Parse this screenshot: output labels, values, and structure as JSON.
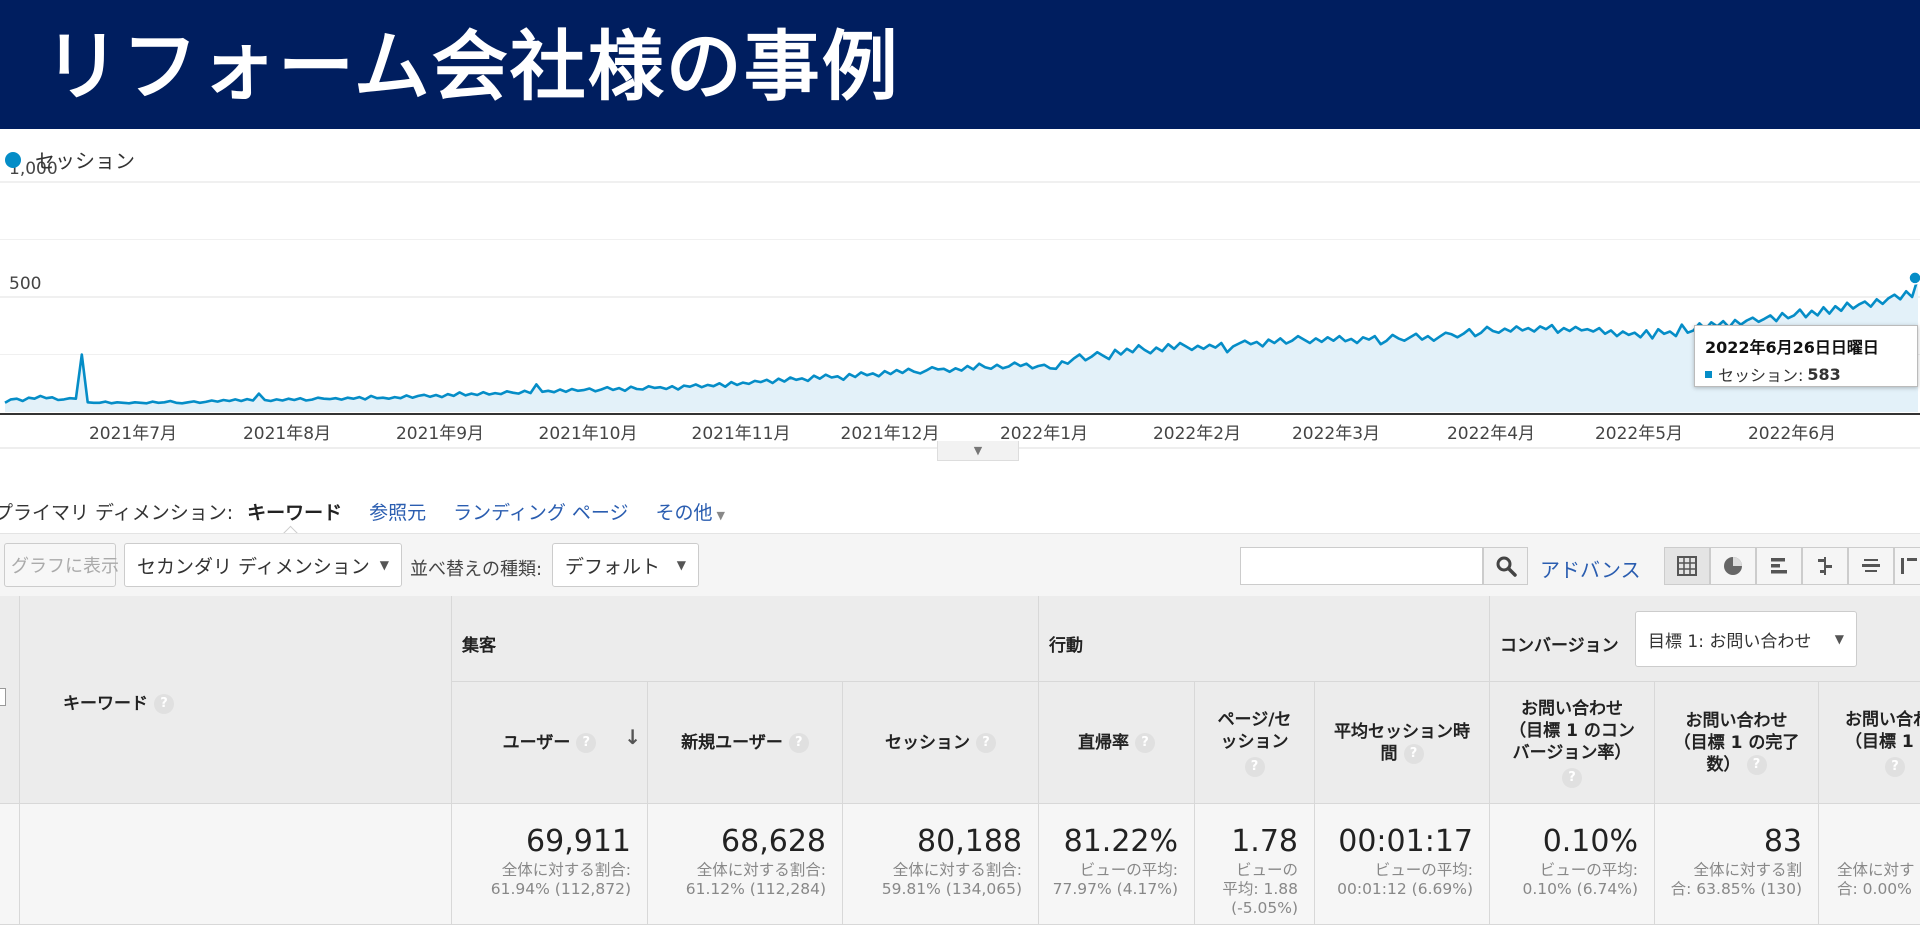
{
  "banner": {
    "title": "リフォーム会社様の事例"
  },
  "chart": {
    "legend_label": "セッション",
    "tooltip": {
      "date": "2022年6月26日日曜日",
      "label": "セッション:",
      "value": "583"
    }
  },
  "chart_data": {
    "type": "area",
    "series": [
      {
        "name": "セッション",
        "values": [
          40,
          55,
          58,
          48,
          62,
          58,
          70,
          60,
          64,
          52,
          55,
          60,
          58,
          250,
          42,
          40,
          40,
          45,
          38,
          42,
          40,
          38,
          42,
          40,
          38,
          45,
          40,
          42,
          48,
          40,
          38,
          42,
          46,
          40,
          44,
          50,
          45,
          52,
          48,
          55,
          48,
          56,
          50,
          80,
          52,
          48,
          55,
          50,
          58,
          52,
          60,
          50,
          54,
          62,
          58,
          56,
          60,
          54,
          62,
          58,
          65,
          55,
          70,
          60,
          62,
          58,
          65,
          60,
          72,
          62,
          70,
          75,
          66,
          74,
          65,
          78,
          70,
          85,
          72,
          80,
          74,
          86,
          76,
          82,
          78,
          90,
          84,
          80,
          92,
          82,
          120,
          88,
          92,
          86,
          98,
          88,
          100,
          92,
          95,
          102,
          90,
          98,
          108,
          96,
          104,
          92,
          110,
          100,
          98,
          112,
          105,
          108,
          100,
          112,
          98,
          115,
          110,
          120,
          108,
          118,
          112,
          125,
          110,
          130,
          118,
          128,
          122,
          135,
          130,
          140,
          126,
          145,
          132,
          150,
          140,
          146,
          135,
          158,
          145,
          162,
          150,
          155,
          140,
          165,
          152,
          172,
          160,
          168,
          155,
          178,
          165,
          182,
          170,
          188,
          175,
          168,
          180,
          195,
          185,
          188,
          175,
          190,
          180,
          200,
          185,
          210,
          195,
          188,
          205,
          190,
          198,
          215,
          200,
          210,
          190,
          200,
          205,
          190,
          188,
          220,
          210,
          232,
          250,
          225,
          240,
          260,
          245,
          230,
          270,
          250,
          275,
          260,
          290,
          270,
          255,
          280,
          265,
          295,
          275,
          300,
          285,
          270,
          288,
          275,
          292,
          280,
          300,
          260,
          285,
          298,
          310,
          295,
          305,
          285,
          315,
          300,
          320,
          298,
          310,
          330,
          315,
          300,
          320,
          305,
          325,
          310,
          330,
          308,
          318,
          300,
          325,
          315,
          330,
          295,
          310,
          335,
          320,
          310,
          325,
          340,
          315,
          330,
          310,
          328,
          345,
          338,
          325,
          340,
          360,
          330,
          345,
          370,
          352,
          345,
          362,
          350,
          372,
          355,
          365,
          350,
          372,
          360,
          378,
          345,
          365,
          352,
          370,
          355,
          360,
          350,
          365,
          340,
          355,
          330,
          350,
          335,
          345,
          325,
          355,
          320,
          360,
          340,
          350,
          330,
          380,
          345,
          355,
          385,
          360,
          390,
          372,
          395,
          368,
          400,
          380,
          398,
          410,
          392,
          405,
          420,
          395,
          430,
          408,
          420,
          445,
          412,
          440,
          420,
          455,
          428,
          460,
          440,
          475,
          450,
          468,
          480,
          458,
          490,
          470,
          495,
          510,
          490,
          525,
          500,
          583
        ]
      }
    ],
    "x_ticks": [
      "2021年7月",
      "2021年8月",
      "2021年9月",
      "2021年10月",
      "2021年11月",
      "2021年12月",
      "2022年1月",
      "2022年2月",
      "2022年3月",
      "2022年4月",
      "2022年5月",
      "2022年6月"
    ],
    "y_ticks": [
      "1,000",
      "500"
    ],
    "ylim": [
      0,
      1000
    ],
    "grid": true,
    "fill_color": "#e3f1f9",
    "line_color": "#058dc7"
  },
  "dimension": {
    "label": "プライマリ ディメンション:",
    "selected": "キーワード",
    "links": [
      "参照元",
      "ランディング ページ",
      "その他"
    ]
  },
  "toolbar": {
    "graph_button": "グラフに表示",
    "secondary_dimension": "セカンダリ ディメンション",
    "sort_label": "並べ替えの種類:",
    "sort_value": "デフォルト",
    "search_value": "",
    "advanced_link": "アドバンス"
  },
  "table": {
    "keyword_header": "キーワード",
    "groups": {
      "acquisition": "集客",
      "behavior": "行動",
      "conversion": "コンバージョン"
    },
    "goal_select": "目標 1: お問い合わせ",
    "columns": [
      {
        "header": "ユーザー",
        "value": "69,911",
        "sub1": "全体に対する割合:",
        "sub2": "61.94% (112,872)"
      },
      {
        "header": "新規ユーザー",
        "value": "68,628",
        "sub1": "全体に対する割合:",
        "sub2": "61.12% (112,284)"
      },
      {
        "header": "セッション",
        "value": "80,188",
        "sub1": "全体に対する割合:",
        "sub2": "59.81% (134,065)"
      },
      {
        "header": "直帰率",
        "value": "81.22%",
        "sub1": "ビューの平均:",
        "sub2": "77.97% (4.17%)"
      },
      {
        "header_l1": "ページ/セ",
        "header_l2": "ッション",
        "value": "1.78",
        "sub1": "ビューの",
        "sub2": "平均: 1.88",
        "sub3": "(-5.05%)"
      },
      {
        "header_l1": "平均セッション時",
        "header_l2": "間",
        "value": "00:01:17",
        "sub1": "ビューの平均:",
        "sub2": "00:01:12 (6.69%)"
      },
      {
        "header_l1": "お問い合わせ",
        "header_l2": "（目標 1 のコン",
        "header_l3": "バージョン率）",
        "value": "0.10%",
        "sub1": "ビューの平均:",
        "sub2": "0.10% (6.74%)"
      },
      {
        "header_l1": "お問い合わせ",
        "header_l2": "（目標 1 の完了",
        "header_l3": "数）",
        "value": "83",
        "sub1": "全体に対する割",
        "sub2": "合: 63.85% (130)"
      },
      {
        "header_l1": "お問い合わ",
        "header_l2": "（目標 1 の",
        "value": "",
        "sub1": "全体に対す",
        "sub2": "合: 0.00%"
      }
    ]
  }
}
